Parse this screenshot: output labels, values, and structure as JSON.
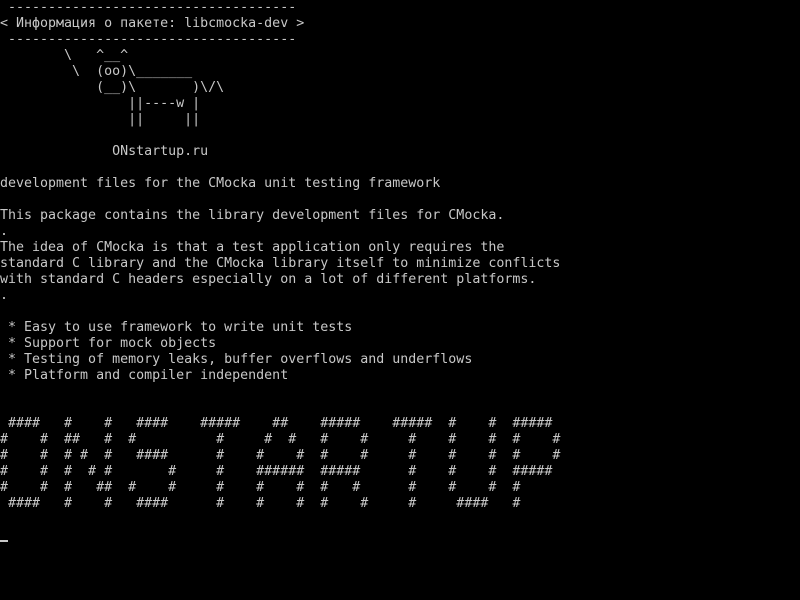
{
  "terminal": {
    "lines": [
      " ------------------------------------",
      "< Информация о пакете: libcmocka-dev >",
      " ------------------------------------",
      "        \\   ^__^",
      "         \\  (oo)\\_______",
      "            (__)\\       )\\/\\",
      "                ||----w |",
      "                ||     ||",
      "",
      "              ONstartup.ru",
      "",
      "development files for the CMocka unit testing framework",
      "",
      "This package contains the library development files for CMocka.",
      ".",
      "The idea of CMocka is that a test application only requires the",
      "standard C library and the CMocka library itself to minimize conflicts",
      "with standard C headers especially on a lot of different platforms.",
      ".",
      "",
      " * Easy to use framework to write unit tests",
      " * Support for mock objects",
      " * Testing of memory leaks, buffer overflows and underflows",
      " * Platform and compiler independent",
      "",
      "",
      " ####   #    #   ####    #####    ##    #####    #####  #    #  #####",
      "#    #  ##   #  #          #     #  #   #    #     #    #    #  #    #",
      "#    #  # #  #   ####      #    #    #  #    #     #    #    #  #    #",
      "#    #  #  # #       #     #    ######  #####      #    #    #  #####",
      "#    #  #   ##  #    #     #    #    #  #   #      #    #    #  #",
      " ####   #    #   ####      #    #    #  #    #     #     ####   #"
    ]
  }
}
